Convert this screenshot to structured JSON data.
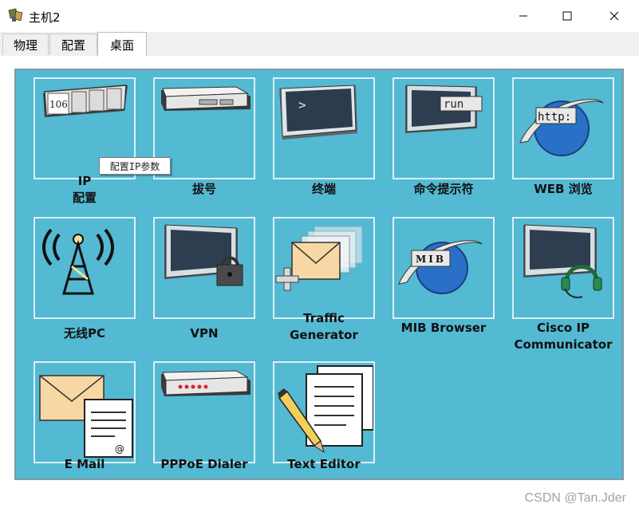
{
  "window": {
    "title": "主机2"
  },
  "tabs": [
    {
      "label": "物理",
      "active": false
    },
    {
      "label": "配置",
      "active": false
    },
    {
      "label": "桌面",
      "active": true
    }
  ],
  "tooltip": "配置IP参数",
  "apps": [
    {
      "line1": "IP",
      "line2": "配置",
      "icon": "ip-config-icon"
    },
    {
      "line1": "拔号",
      "line2": "",
      "icon": "dialup-modem-icon"
    },
    {
      "line1": "终端",
      "line2": "",
      "icon": "terminal-icon"
    },
    {
      "line1": "命令提示符",
      "line2": "",
      "icon": "command-prompt-icon",
      "icon_text": "run"
    },
    {
      "line1": "WEB 浏览",
      "line2": "",
      "icon": "web-browser-icon",
      "icon_text": "http:"
    },
    {
      "line1": "无线PC",
      "line2": "",
      "icon": "wireless-tower-icon"
    },
    {
      "line1": "VPN",
      "line2": "",
      "icon": "vpn-lock-icon"
    },
    {
      "line1": "Traffic",
      "line2": "Generator",
      "icon": "traffic-generator-icon"
    },
    {
      "line1": "MIB Browser",
      "line2": "",
      "icon": "mib-globe-icon",
      "icon_text": "MIB"
    },
    {
      "line1": "Cisco IP",
      "line2": "Communicator",
      "icon": "headset-monitor-icon"
    },
    {
      "line1": "E Mail",
      "line2": "",
      "icon": "email-envelope-icon"
    },
    {
      "line1": "PPPoE Dialer",
      "line2": "",
      "icon": "pppoe-modem-icon"
    },
    {
      "line1": "Text Editor",
      "line2": "",
      "icon": "text-editor-icon"
    }
  ],
  "ip_icon_text": "106",
  "watermark": "CSDN @Tan.Jder",
  "colors": {
    "desktop_bg": "#54b9d2",
    "tile_border": "#d9f1f8",
    "tab_bg": "#f0f0f0"
  }
}
